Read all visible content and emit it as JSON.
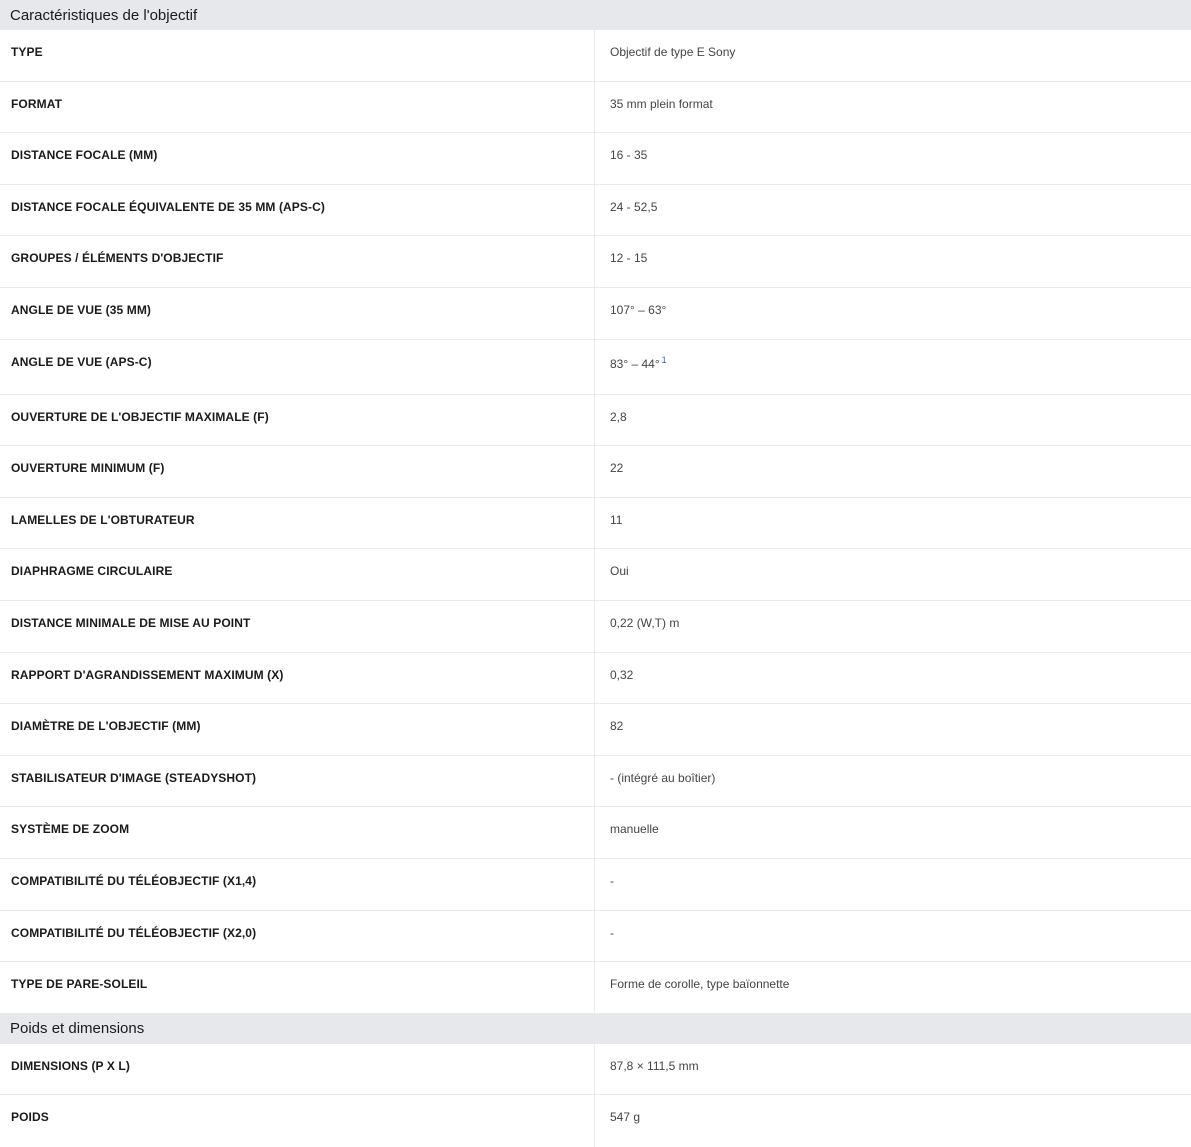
{
  "sections": [
    {
      "title": "Caractéristiques de l'objectif",
      "rows": [
        {
          "label": "TYPE",
          "value": "Objectif de type E Sony"
        },
        {
          "label": "FORMAT",
          "value": "35 mm plein format"
        },
        {
          "label": "DISTANCE FOCALE (MM)",
          "value": "16 - 35"
        },
        {
          "label": "DISTANCE FOCALE ÉQUIVALENTE DE 35 MM (APS-C)",
          "value": "24 - 52,5"
        },
        {
          "label": "GROUPES / ÉLÉMENTS D'OBJECTIF",
          "value": "12 - 15"
        },
        {
          "label": "ANGLE DE VUE (35 MM)",
          "value": "107° – 63°"
        },
        {
          "label": "ANGLE DE VUE (APS-C)",
          "value": "83° – 44°",
          "footnote": "1"
        },
        {
          "label": "OUVERTURE DE L'OBJECTIF MAXIMALE (F)",
          "value": "2,8"
        },
        {
          "label": "OUVERTURE MINIMUM (F)",
          "value": "22"
        },
        {
          "label": "LAMELLES DE L'OBTURATEUR",
          "value": "11"
        },
        {
          "label": "DIAPHRAGME CIRCULAIRE",
          "value": "Oui"
        },
        {
          "label": "DISTANCE MINIMALE DE MISE AU POINT",
          "value": "0,22 (W,T) m"
        },
        {
          "label": "RAPPORT D'AGRANDISSEMENT MAXIMUM (X)",
          "value": "0,32"
        },
        {
          "label": "DIAMÈTRE DE L'OBJECTIF (MM)",
          "value": "82"
        },
        {
          "label": "STABILISATEUR D'IMAGE (STEADYSHOT)",
          "value": "- (intégré au boîtier)"
        },
        {
          "label": "SYSTÈME DE ZOOM",
          "value": "manuelle"
        },
        {
          "label": "COMPATIBILITÉ DU TÉLÉOBJECTIF (X1,4)",
          "value": "-"
        },
        {
          "label": "COMPATIBILITÉ DU TÉLÉOBJECTIF (X2,0)",
          "value": "-"
        },
        {
          "label": "TYPE DE PARE-SOLEIL",
          "value": "Forme de corolle, type baïonnette"
        }
      ]
    },
    {
      "title": "Poids et dimensions",
      "rows": [
        {
          "label": "DIMENSIONS (P X L)",
          "value": "87,8 × 111,5 mm"
        },
        {
          "label": "POIDS",
          "value": "547 g"
        }
      ]
    }
  ]
}
